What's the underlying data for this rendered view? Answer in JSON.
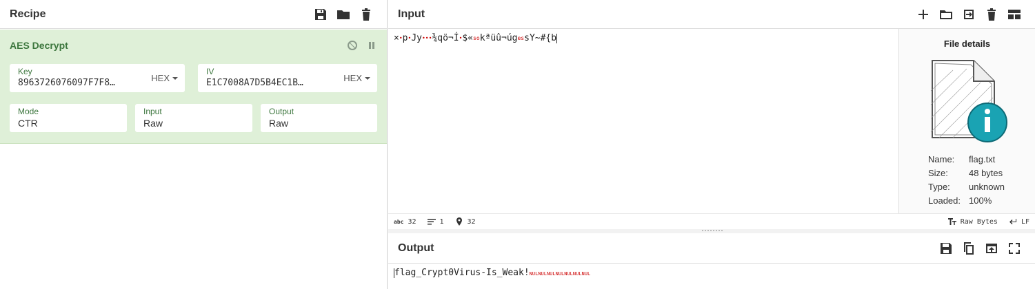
{
  "recipe": {
    "title": "Recipe",
    "operation": {
      "name": "AES Decrypt",
      "key": {
        "label": "Key",
        "value": "8963726076097F7F8…",
        "format": "HEX"
      },
      "iv": {
        "label": "IV",
        "value": "E1C7008A7D5B4EC1B…",
        "format": "HEX"
      },
      "mode": {
        "label": "Mode",
        "value": "CTR"
      },
      "input": {
        "label": "Input",
        "value": "Raw"
      },
      "output": {
        "label": "Output",
        "value": "Raw"
      }
    }
  },
  "input": {
    "title": "Input",
    "text_segments": [
      "×",
      "•",
      "p",
      "•",
      "Jy",
      "•••",
      "¾qö¬Í",
      "•",
      "$«",
      "so",
      "kªüû¬úg",
      "es",
      "sY~#{b"
    ],
    "file_details": {
      "title": "File details",
      "name_label": "Name:",
      "name_value": "flag.txt",
      "size_label": "Size:",
      "size_value": "48 bytes",
      "type_label": "Type:",
      "type_value": "unknown",
      "loaded_label": "Loaded:",
      "loaded_value": "100%"
    },
    "status": {
      "chars": "32",
      "lines": "1",
      "position": "32",
      "encoding": "Raw Bytes",
      "eol": "LF",
      "chars_icon": "abc"
    }
  },
  "output": {
    "title": "Output",
    "text": "flag_Crypt0Virus-Is_Weak!",
    "nul_marks": "NULNULNULNULNULNULNUL"
  },
  "icons": {
    "recipe": [
      "save-icon",
      "folder-icon",
      "trash-icon"
    ],
    "input": [
      "plus-icon",
      "folder-icon",
      "import-icon",
      "trash-icon",
      "layout-icon"
    ],
    "output": [
      "save-icon",
      "copy-icon",
      "replace-input-icon",
      "maximize-icon"
    ]
  }
}
